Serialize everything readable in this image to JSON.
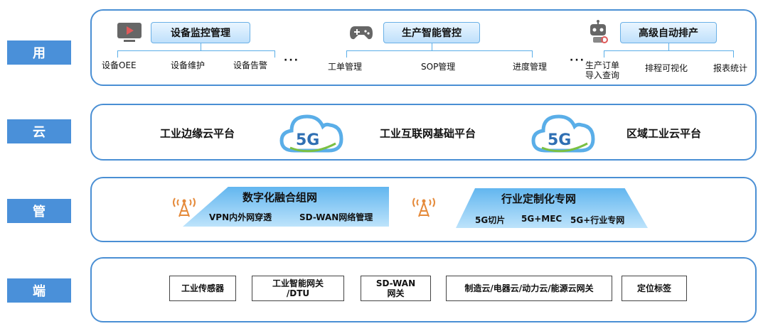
{
  "side_labels": [
    "用",
    "云",
    "管",
    "端"
  ],
  "app_layer": {
    "groups": [
      {
        "title": "设备监控管理",
        "icon": "monitor-play-icon",
        "items": [
          "设备OEE",
          "设备维护",
          "设备告警"
        ]
      },
      {
        "title": "生产智能管控",
        "icon": "gamepad-icon",
        "items": [
          "工单管理",
          "SOP管理",
          "进度管理"
        ]
      },
      {
        "title": "高级自动排产",
        "icon": "robot-icon",
        "items": [
          "生产订单",
          "导入查询",
          "排程可视化",
          "报表统计"
        ]
      }
    ],
    "ellipsis": "···"
  },
  "cloud_layer": {
    "platforms": [
      "工业边缘云平台",
      "工业互联网基础平台",
      "区域工业云平台"
    ],
    "badge_text": "5G"
  },
  "pipe_layer": {
    "networks": [
      {
        "title": "数字化融合组网",
        "items": [
          "VPN内外网穿透",
          "SD-WAN网络管理"
        ]
      },
      {
        "title": "行业定制化专网",
        "items": [
          "5G切片",
          "5G+MEC",
          "5G+行业专网"
        ]
      }
    ]
  },
  "device_layer": {
    "items": [
      [
        "工业传感器"
      ],
      [
        "工业智能网关",
        "/DTU"
      ],
      [
        "SD-WAN",
        "网关"
      ],
      [
        "制造云/电器云/动力云/能源云网关"
      ],
      [
        "定位标签"
      ]
    ]
  },
  "colors": {
    "accent": "#4a90d9",
    "border": "#4a8fd4",
    "pill_fill": "#bfe0fb",
    "tower": "#e58a3a"
  }
}
